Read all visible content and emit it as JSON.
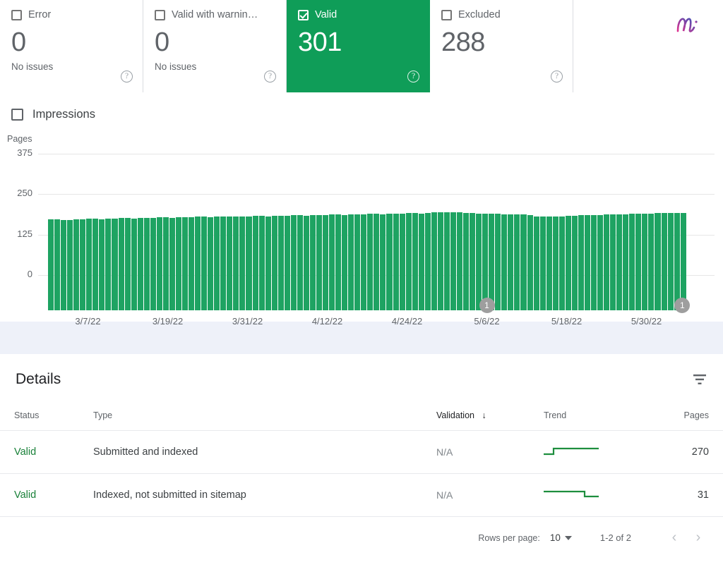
{
  "brand": {
    "logo_icon": "m-script-logo",
    "gradient_from": "#e0318f",
    "gradient_to": "#3f51b5"
  },
  "status_cards": [
    {
      "label": "Error",
      "value": "0",
      "sub": "No issues",
      "checked": false,
      "active": false,
      "help_icon": "help-icon"
    },
    {
      "label": "Valid with warnin…",
      "value": "0",
      "sub": "No issues",
      "checked": false,
      "active": false,
      "help_icon": "help-icon"
    },
    {
      "label": "Valid",
      "value": "301",
      "sub": "",
      "checked": true,
      "active": true,
      "help_icon": "help-icon"
    },
    {
      "label": "Excluded",
      "value": "288",
      "sub": "",
      "checked": false,
      "active": false,
      "help_icon": "help-icon"
    }
  ],
  "chart_toggle": {
    "label": "Impressions",
    "checked": false
  },
  "chart_data": {
    "type": "bar",
    "title": "",
    "xlabel": "",
    "ylabel": "Pages",
    "ylim": [
      0,
      375
    ],
    "yticks": [
      "0",
      "125",
      "250",
      "375"
    ],
    "grid": true,
    "legend": "none",
    "series_color": "#1ea362",
    "categories": [
      "3/7/22",
      "3/19/22",
      "3/31/22",
      "4/12/22",
      "4/24/22",
      "5/6/22",
      "5/18/22",
      "5/30/22"
    ],
    "tick_dates": [
      "3/7/22",
      "3/19/22",
      "3/31/22",
      "4/12/22",
      "4/24/22",
      "5/6/22",
      "5/18/22",
      "5/30/22"
    ],
    "values": [
      282,
      281,
      280,
      280,
      282,
      281,
      283,
      283,
      282,
      284,
      284,
      285,
      285,
      284,
      286,
      286,
      285,
      287,
      287,
      286,
      288,
      288,
      287,
      289,
      289,
      288,
      290,
      290,
      289,
      291,
      291,
      290,
      292,
      292,
      291,
      293,
      293,
      292,
      294,
      294,
      293,
      295,
      295,
      294,
      296,
      296,
      295,
      297,
      297,
      296,
      298,
      298,
      297,
      299,
      299,
      298,
      300,
      300,
      299,
      301,
      302,
      303,
      304,
      303,
      302,
      301,
      300,
      299,
      299,
      298,
      298,
      297,
      297,
      296,
      296,
      295,
      290,
      289,
      289,
      290,
      291,
      292,
      293,
      294,
      294,
      295,
      295,
      296,
      296,
      297,
      297,
      298,
      298,
      299,
      299,
      300,
      300,
      301,
      301,
      300
    ],
    "annotations": [
      {
        "label": "1",
        "near_tick": "5/6/22"
      },
      {
        "label": "1",
        "near_tick": "end"
      }
    ]
  },
  "details": {
    "title": "Details",
    "filter_icon": "filter-icon",
    "columns": [
      {
        "key": "status",
        "label": "Status",
        "sorted": false
      },
      {
        "key": "type",
        "label": "Type",
        "sorted": false
      },
      {
        "key": "validation",
        "label": "Validation",
        "sorted": true,
        "sort_icon": "arrow-down-icon"
      },
      {
        "key": "trend",
        "label": "Trend",
        "sorted": false
      },
      {
        "key": "pages",
        "label": "Pages",
        "sorted": false
      }
    ],
    "rows": [
      {
        "status": "Valid",
        "type": "Submitted and indexed",
        "validation": "N/A",
        "trend_shape": "step-up",
        "pages": "270"
      },
      {
        "status": "Valid",
        "type": "Indexed, not submitted in sitemap",
        "validation": "N/A",
        "trend_shape": "step-down",
        "pages": "31"
      }
    ],
    "pagination": {
      "rows_per_page_label": "Rows per page:",
      "rows_per_page_value": "10",
      "dropdown_icon": "chevron-down-icon",
      "range": "1-2 of 2",
      "prev_icon": "chevron-left-icon",
      "next_icon": "chevron-right-icon"
    }
  }
}
